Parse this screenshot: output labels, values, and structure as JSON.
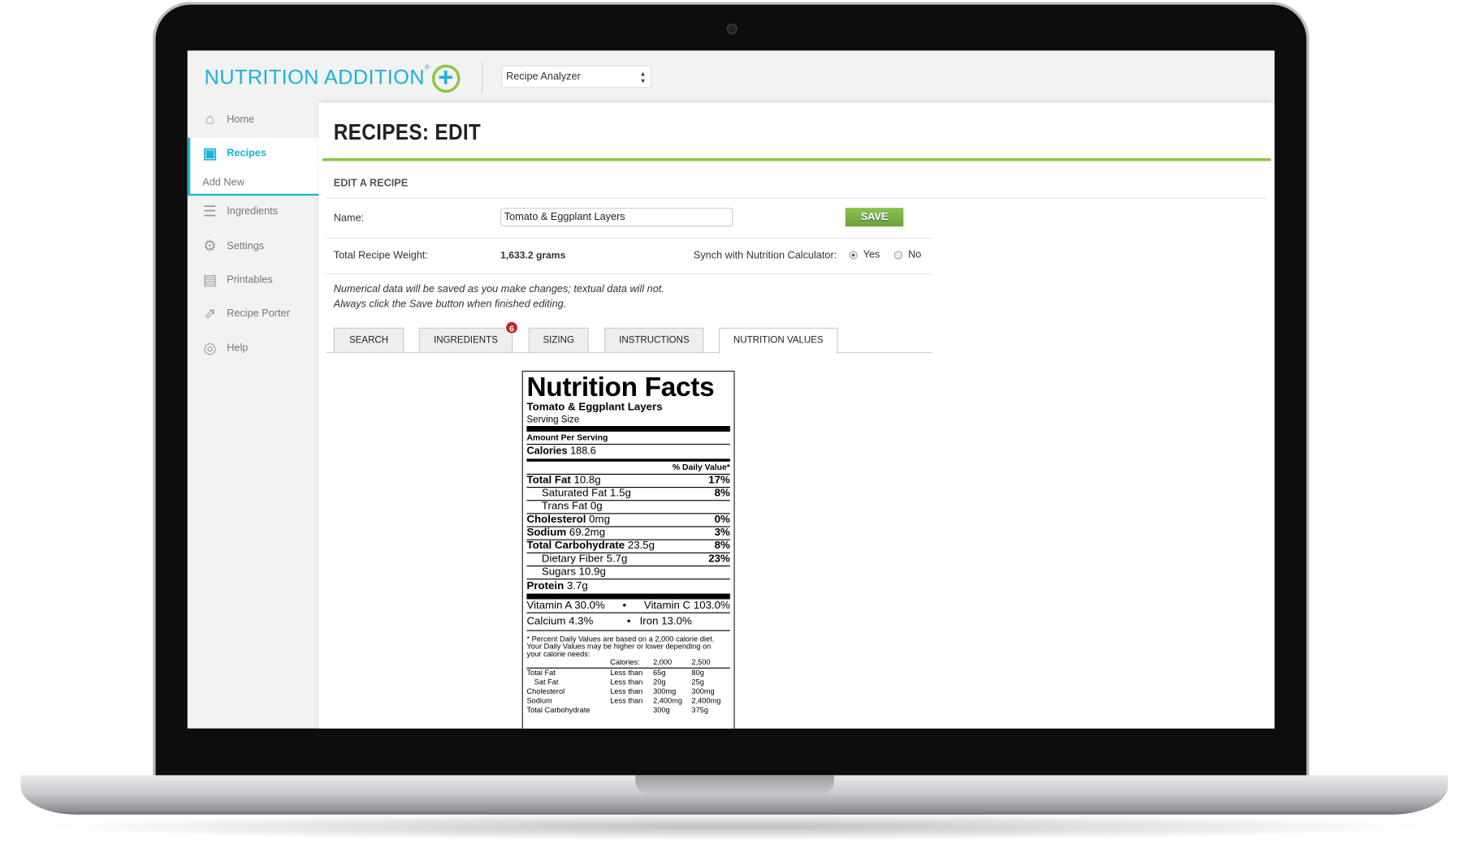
{
  "app": {
    "logo": "NUTRITION ADDITION",
    "select_value": "Recipe Analyzer"
  },
  "sidebar": {
    "items": [
      {
        "label": "Home",
        "icon": "home-icon"
      },
      {
        "label": "Recipes",
        "icon": "recipe-book-icon",
        "active": true
      },
      {
        "label": "Add New"
      },
      {
        "label": "Ingredients",
        "icon": "list-icon"
      },
      {
        "label": "Settings",
        "icon": "gear-icon"
      },
      {
        "label": "Printables",
        "icon": "printer-icon"
      },
      {
        "label": "Recipe Porter",
        "icon": "export-icon"
      },
      {
        "label": "Help",
        "icon": "lifebuoy-icon"
      }
    ]
  },
  "main": {
    "title": "RECIPES: EDIT",
    "section": "EDIT A RECIPE",
    "name_label": "Name:",
    "name_value": "Tomato & Eggplant Layers",
    "save_label": "SAVE",
    "weight_label": "Total Recipe Weight:",
    "weight_value": "1,633.2 grams",
    "synch_label": "Synch with Nutrition Calculator:",
    "yes": "Yes",
    "no": "No",
    "synch_selected": "Yes",
    "note1": "Numerical data will be saved as you make changes; textual data will not.",
    "note2": "Always click the Save button when finished editing.",
    "tabs": [
      "SEARCH",
      "INGREDIENTS",
      "SIZING",
      "INSTRUCTIONS",
      "NUTRITION VALUES"
    ],
    "active_tab": "NUTRITION VALUES",
    "ingredients_badge": "6",
    "accent": "#8dc63f",
    "brand": "#1ab3d9"
  },
  "nf": {
    "title": "Nutrition Facts",
    "recipe": "Tomato & Eggplant Layers",
    "serving": "Serving Size",
    "amount": "Amount Per Serving",
    "cal_label": "Calories",
    "cal": "188.6",
    "dv": "% Daily Value*",
    "rows": [
      {
        "name": "Total Fat",
        "val": "10.8g",
        "pct": "17%",
        "bold": true
      },
      {
        "name": "Saturated Fat",
        "val": "1.5g",
        "pct": "8%"
      },
      {
        "name": "Trans Fat",
        "val": "0g",
        "pct": ""
      },
      {
        "name": "Cholesterol",
        "val": "0mg",
        "pct": "0%",
        "bold": true
      },
      {
        "name": "Sodium",
        "val": "69.2mg",
        "pct": "3%",
        "bold": true
      },
      {
        "name": "Total Carbohydrate",
        "val": "23.5g",
        "pct": "8%",
        "bold": true
      },
      {
        "name": "Dietary Fiber",
        "val": "5.7g",
        "pct": "23%"
      },
      {
        "name": "Sugars",
        "val": "10.9g",
        "pct": ""
      },
      {
        "name": "Protein",
        "val": "3.7g",
        "pct": "",
        "bold": true
      }
    ],
    "vitA": "Vitamin A 30.0%",
    "vitC": "Vitamin C 103.0%",
    "calcium": "Calcium 4.3%",
    "iron": "Iron 13.0%",
    "footnote": "* Percent Daily Values are based on a 2,000 calorie diet. Your Daily Values may be higher or lower depending on your calorie needs:",
    "table_head": [
      "",
      "Calories:",
      "2,000",
      "2,500"
    ],
    "table": [
      [
        "Total Fat",
        "Less than",
        "65g",
        "80g"
      ],
      [
        "Sat Fat",
        "Less than",
        "20g",
        "25g"
      ],
      [
        "Cholesterol",
        "Less than",
        "300mg",
        "300mg"
      ],
      [
        "Sodium",
        "Less than",
        "2,400mg",
        "2,400mg"
      ],
      [
        "Total Carbohydrate",
        "",
        "300g",
        "375g"
      ]
    ]
  }
}
